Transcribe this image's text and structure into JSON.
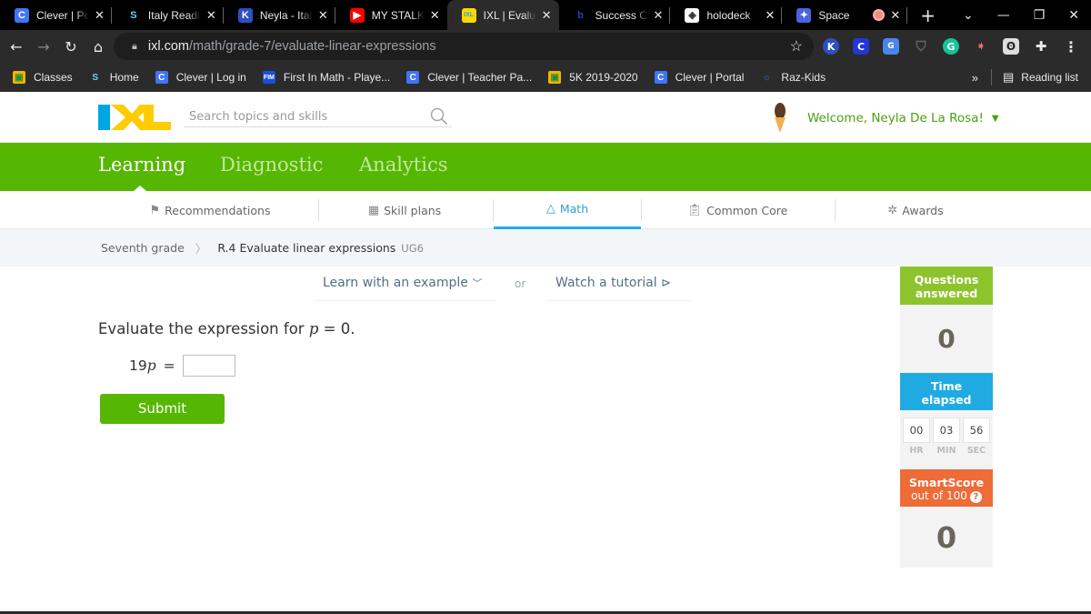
{
  "browser": {
    "tabs": [
      {
        "title": "Clever | Portal",
        "icon": "C",
        "icon_bg": "#4274f6",
        "icon_color": "#fff"
      },
      {
        "title": "Italy Reading",
        "icon": "S",
        "icon_bg": "#000",
        "icon_color": "#6ad3ef"
      },
      {
        "title": "Neyla - Italy",
        "icon": "K",
        "icon_bg": "#2d4fc4",
        "icon_color": "#fff"
      },
      {
        "title": "MY STALKER",
        "icon": "▶",
        "icon_bg": "#ff0000",
        "icon_color": "#fff"
      },
      {
        "title": "IXL | Evaluate",
        "icon": "IXL",
        "icon_bg": "#ffd700",
        "icon_color": "#1da9e2",
        "active": true
      },
      {
        "title": "Success Criteria",
        "icon": "b",
        "icon_bg": "#000",
        "icon_color": "#2a3bc0"
      },
      {
        "title": "holodeck",
        "icon": "◈",
        "icon_bg": "#fff",
        "icon_color": "#333"
      },
      {
        "title": "Space",
        "icon": "✦",
        "icon_bg": "#4a63e0",
        "icon_color": "#fff",
        "recording": true
      }
    ],
    "new_tab": "+",
    "url_host": "ixl.com",
    "url_path": "/math/grade-7/evaluate-linear-expressions",
    "bookmarks": [
      {
        "label": "Classes",
        "icon": "▣",
        "bg": "#f5b400",
        "fg": "#1e8e3e"
      },
      {
        "label": "Home",
        "icon": "S",
        "bg": "#2b2b2b",
        "fg": "#6ad3ef"
      },
      {
        "label": "Clever | Log in",
        "icon": "C",
        "bg": "#4274f6",
        "fg": "#fff"
      },
      {
        "label": "First In Math - Playe...",
        "icon": "FIM",
        "bg": "#1a4fd8",
        "fg": "#fff"
      },
      {
        "label": "Clever | Teacher Pa...",
        "icon": "C",
        "bg": "#4274f6",
        "fg": "#fff"
      },
      {
        "label": "5K 2019-2020",
        "icon": "▣",
        "bg": "#f5b400",
        "fg": "#1e8e3e"
      },
      {
        "label": "Clever | Portal",
        "icon": "C",
        "bg": "#4274f6",
        "fg": "#fff"
      },
      {
        "label": "Raz-Kids",
        "icon": "☼",
        "bg": "#2b2b2b",
        "fg": "#3b6fd9"
      }
    ],
    "more_bookmarks": "»",
    "reading_list": "Reading list"
  },
  "ixl": {
    "search_placeholder": "Search topics and skills",
    "welcome": "Welcome, Neyla De La Rosa!",
    "main_tabs": [
      "Learning",
      "Diagnostic",
      "Analytics"
    ],
    "active_main_tab": "Learning",
    "sub_tabs": [
      "Recommendations",
      "Skill plans",
      "Math",
      "Common Core",
      "Awards"
    ],
    "active_sub_tab": "Math",
    "breadcrumb": {
      "parent": "Seventh grade",
      "current": "R.4 Evaluate linear expressions",
      "code": "UG6"
    },
    "learn_example": "Learn with an example",
    "or": "or",
    "watch_tutorial": "Watch a tutorial",
    "question_prefix": "Evaluate the expression for",
    "question_var": "p",
    "question_suffix": "= 0.",
    "expr_coef": "19",
    "expr_var": "p",
    "expr_eq": "=",
    "answer_value": "",
    "submit": "Submit"
  },
  "sidebar": {
    "questions_label_1": "Questions",
    "questions_label_2": "answered",
    "questions_value": "0",
    "time_label_1": "Time",
    "time_label_2": "elapsed",
    "time": {
      "hr": "00",
      "min": "03",
      "sec": "56"
    },
    "time_units": {
      "hr": "HR",
      "min": "MIN",
      "sec": "SEC"
    },
    "smartscore_label": "SmartScore",
    "smartscore_sub": "out of 100",
    "smartscore_value": "0"
  }
}
